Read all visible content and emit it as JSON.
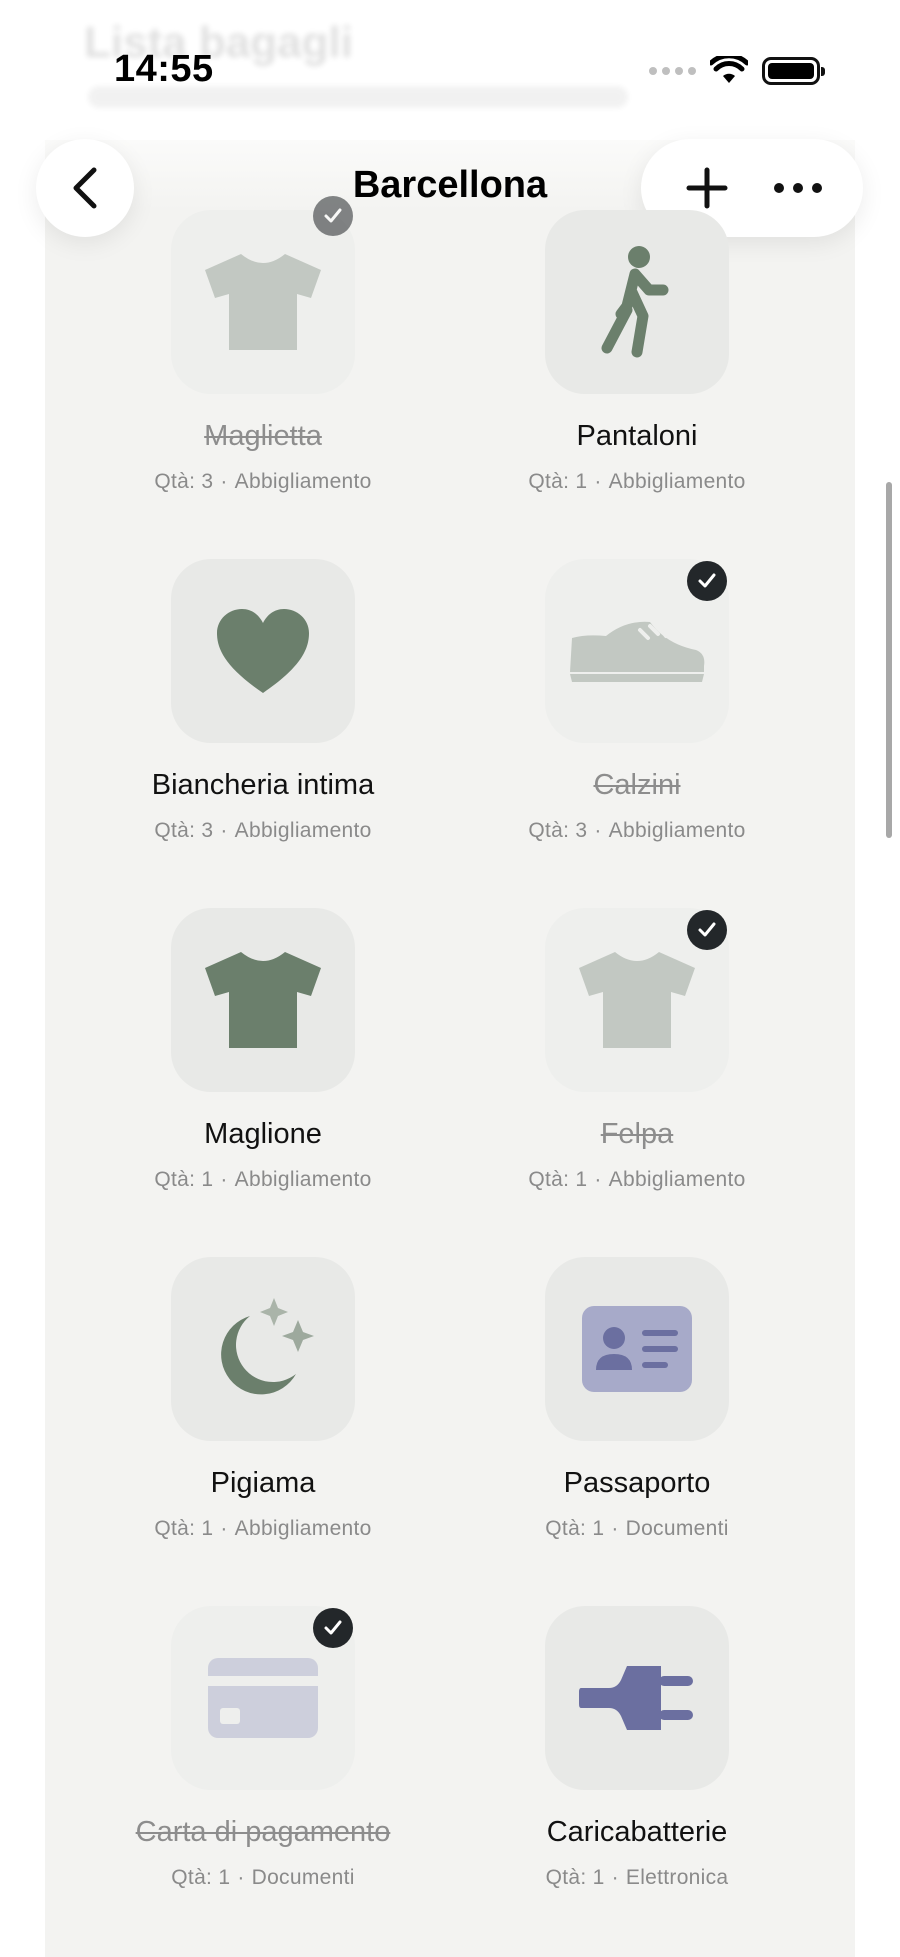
{
  "status_bar": {
    "time": "14:55"
  },
  "background_title": "Lista bagagli",
  "nav": {
    "title": "Barcellona"
  },
  "qty_label": "Qtà:",
  "items": [
    {
      "name": "Maglietta",
      "qty": "3",
      "category": "Abbigliamento",
      "packed": true,
      "icon": "tshirt-icon"
    },
    {
      "name": "Pantaloni",
      "qty": "1",
      "category": "Abbigliamento",
      "packed": false,
      "icon": "walking-person-icon"
    },
    {
      "name": "Biancheria intima",
      "qty": "3",
      "category": "Abbigliamento",
      "packed": false,
      "icon": "heart-icon"
    },
    {
      "name": "Calzini",
      "qty": "3",
      "category": "Abbigliamento",
      "packed": true,
      "icon": "shoe-icon"
    },
    {
      "name": "Maglione",
      "qty": "1",
      "category": "Abbigliamento",
      "packed": false,
      "icon": "tshirt-icon"
    },
    {
      "name": "Felpa",
      "qty": "1",
      "category": "Abbigliamento",
      "packed": true,
      "icon": "tshirt-icon"
    },
    {
      "name": "Pigiama",
      "qty": "1",
      "category": "Abbigliamento",
      "packed": false,
      "icon": "moon-stars-icon"
    },
    {
      "name": "Passaporto",
      "qty": "1",
      "category": "Documenti",
      "packed": false,
      "icon": "id-card-icon"
    },
    {
      "name": "Carta di pagamento",
      "qty": "1",
      "category": "Documenti",
      "packed": true,
      "icon": "credit-card-icon"
    },
    {
      "name": "Caricabatterie",
      "qty": "1",
      "category": "Elettronica",
      "packed": false,
      "icon": "plug-icon"
    }
  ],
  "colors": {
    "clothing_icon": "#6b7f6c",
    "document_icon": "#8f92b8",
    "electronics_icon": "#6b6fa0",
    "check_badge": "#23272a"
  }
}
